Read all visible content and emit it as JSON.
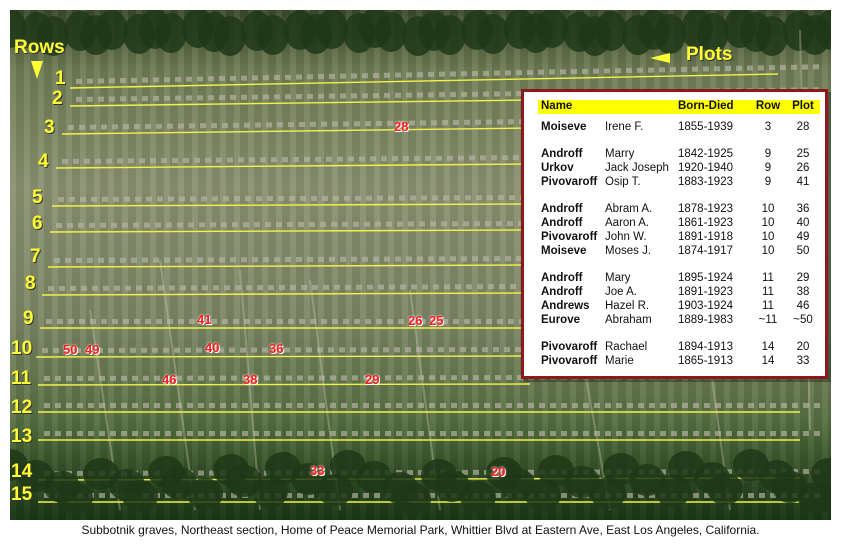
{
  "header": {
    "rows_label": "Rows",
    "plots_label": "Plots"
  },
  "rows": [
    "1",
    "2",
    "3",
    "4",
    "5",
    "6",
    "7",
    "8",
    "9",
    "10",
    "11",
    "12",
    "13",
    "14",
    "15"
  ],
  "plot_markers": [
    "28",
    "41",
    "26",
    "25",
    "50",
    "49",
    "40",
    "36",
    "46",
    "38",
    "29",
    "33",
    "20"
  ],
  "legend": {
    "columns": {
      "name": "Name",
      "born_died": "Born-Died",
      "row": "Row",
      "plot": "Plot"
    },
    "entries": [
      {
        "last": "Moiseve",
        "first": "Irene F.",
        "dates": "1855-1939",
        "row": "3",
        "plot": "28"
      },
      {
        "last": "Androff",
        "first": "Marry",
        "dates": "1842-1925",
        "row": "9",
        "plot": "25"
      },
      {
        "last": "Urkov",
        "first": "Jack Joseph",
        "dates": "1920-1940",
        "row": "9",
        "plot": "26"
      },
      {
        "last": "Pivovaroff",
        "first": "Osip T.",
        "dates": "1883-1923",
        "row": "9",
        "plot": "41"
      },
      {
        "last": "Androff",
        "first": "Abram A.",
        "dates": "1878-1923",
        "row": "10",
        "plot": "36"
      },
      {
        "last": "Androff",
        "first": "Aaron A.",
        "dates": "1861-1923",
        "row": "10",
        "plot": "40"
      },
      {
        "last": "Pivovaroff",
        "first": "John W.",
        "dates": "1891-1918",
        "row": "10",
        "plot": "49"
      },
      {
        "last": "Moiseve",
        "first": "Moses J.",
        "dates": "1874-1917",
        "row": "10",
        "plot": "50"
      },
      {
        "last": "Androff",
        "first": "Mary",
        "dates": "1895-1924",
        "row": "11",
        "plot": "29"
      },
      {
        "last": "Androff",
        "first": "Joe A.",
        "dates": "1891-1923",
        "row": "11",
        "plot": "38"
      },
      {
        "last": "Andrews",
        "first": "Hazel R.",
        "dates": "1903-1924",
        "row": "11",
        "plot": "46"
      },
      {
        "last": "Eurove",
        "first": "Abraham",
        "dates": "1889-1983",
        "row": "~11",
        "plot": "~50"
      },
      {
        "last": "Pivovaroff",
        "first": "Rachael",
        "dates": "1894-1913",
        "row": "14",
        "plot": "20"
      },
      {
        "last": "Pivovaroff",
        "first": "Marie",
        "dates": "1865-1913",
        "row": "14",
        "plot": "33"
      }
    ]
  },
  "caption": "Subbotnik graves, Northeast section, Home of Peace Memorial Park, Whittier Blvd at Eastern Ave, East Los Angeles, California.",
  "colors": {
    "row_line": "#f2f24a",
    "label_yellow": "#ffff33",
    "plot_red": "#ff1c1c",
    "legend_border": "#8b1a1a",
    "legend_header": "#ffff00"
  }
}
